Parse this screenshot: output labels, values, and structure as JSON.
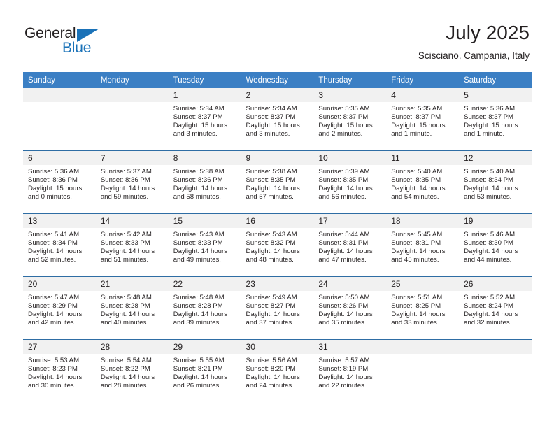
{
  "brand": {
    "name_part1": "General",
    "name_part2": "Blue",
    "triangle_color": "#1a72b8",
    "text_color": "#231f20"
  },
  "header": {
    "title": "July 2025",
    "subtitle": "Scisciano, Campania, Italy"
  },
  "calendar": {
    "header_bg": "#3b7fc4",
    "header_text_color": "#ffffff",
    "daynum_bg": "#f1f1f1",
    "week_separator_color": "#2e6da4",
    "weekdays": [
      "Sunday",
      "Monday",
      "Tuesday",
      "Wednesday",
      "Thursday",
      "Friday",
      "Saturday"
    ],
    "weeks": [
      [
        {
          "day": "",
          "lines": []
        },
        {
          "day": "",
          "lines": []
        },
        {
          "day": "1",
          "lines": [
            "Sunrise: 5:34 AM",
            "Sunset: 8:37 PM",
            "Daylight: 15 hours and 3 minutes."
          ]
        },
        {
          "day": "2",
          "lines": [
            "Sunrise: 5:34 AM",
            "Sunset: 8:37 PM",
            "Daylight: 15 hours and 3 minutes."
          ]
        },
        {
          "day": "3",
          "lines": [
            "Sunrise: 5:35 AM",
            "Sunset: 8:37 PM",
            "Daylight: 15 hours and 2 minutes."
          ]
        },
        {
          "day": "4",
          "lines": [
            "Sunrise: 5:35 AM",
            "Sunset: 8:37 PM",
            "Daylight: 15 hours and 1 minute."
          ]
        },
        {
          "day": "5",
          "lines": [
            "Sunrise: 5:36 AM",
            "Sunset: 8:37 PM",
            "Daylight: 15 hours and 1 minute."
          ]
        }
      ],
      [
        {
          "day": "6",
          "lines": [
            "Sunrise: 5:36 AM",
            "Sunset: 8:36 PM",
            "Daylight: 15 hours and 0 minutes."
          ]
        },
        {
          "day": "7",
          "lines": [
            "Sunrise: 5:37 AM",
            "Sunset: 8:36 PM",
            "Daylight: 14 hours and 59 minutes."
          ]
        },
        {
          "day": "8",
          "lines": [
            "Sunrise: 5:38 AM",
            "Sunset: 8:36 PM",
            "Daylight: 14 hours and 58 minutes."
          ]
        },
        {
          "day": "9",
          "lines": [
            "Sunrise: 5:38 AM",
            "Sunset: 8:35 PM",
            "Daylight: 14 hours and 57 minutes."
          ]
        },
        {
          "day": "10",
          "lines": [
            "Sunrise: 5:39 AM",
            "Sunset: 8:35 PM",
            "Daylight: 14 hours and 56 minutes."
          ]
        },
        {
          "day": "11",
          "lines": [
            "Sunrise: 5:40 AM",
            "Sunset: 8:35 PM",
            "Daylight: 14 hours and 54 minutes."
          ]
        },
        {
          "day": "12",
          "lines": [
            "Sunrise: 5:40 AM",
            "Sunset: 8:34 PM",
            "Daylight: 14 hours and 53 minutes."
          ]
        }
      ],
      [
        {
          "day": "13",
          "lines": [
            "Sunrise: 5:41 AM",
            "Sunset: 8:34 PM",
            "Daylight: 14 hours and 52 minutes."
          ]
        },
        {
          "day": "14",
          "lines": [
            "Sunrise: 5:42 AM",
            "Sunset: 8:33 PM",
            "Daylight: 14 hours and 51 minutes."
          ]
        },
        {
          "day": "15",
          "lines": [
            "Sunrise: 5:43 AM",
            "Sunset: 8:33 PM",
            "Daylight: 14 hours and 49 minutes."
          ]
        },
        {
          "day": "16",
          "lines": [
            "Sunrise: 5:43 AM",
            "Sunset: 8:32 PM",
            "Daylight: 14 hours and 48 minutes."
          ]
        },
        {
          "day": "17",
          "lines": [
            "Sunrise: 5:44 AM",
            "Sunset: 8:31 PM",
            "Daylight: 14 hours and 47 minutes."
          ]
        },
        {
          "day": "18",
          "lines": [
            "Sunrise: 5:45 AM",
            "Sunset: 8:31 PM",
            "Daylight: 14 hours and 45 minutes."
          ]
        },
        {
          "day": "19",
          "lines": [
            "Sunrise: 5:46 AM",
            "Sunset: 8:30 PM",
            "Daylight: 14 hours and 44 minutes."
          ]
        }
      ],
      [
        {
          "day": "20",
          "lines": [
            "Sunrise: 5:47 AM",
            "Sunset: 8:29 PM",
            "Daylight: 14 hours and 42 minutes."
          ]
        },
        {
          "day": "21",
          "lines": [
            "Sunrise: 5:48 AM",
            "Sunset: 8:28 PM",
            "Daylight: 14 hours and 40 minutes."
          ]
        },
        {
          "day": "22",
          "lines": [
            "Sunrise: 5:48 AM",
            "Sunset: 8:28 PM",
            "Daylight: 14 hours and 39 minutes."
          ]
        },
        {
          "day": "23",
          "lines": [
            "Sunrise: 5:49 AM",
            "Sunset: 8:27 PM",
            "Daylight: 14 hours and 37 minutes."
          ]
        },
        {
          "day": "24",
          "lines": [
            "Sunrise: 5:50 AM",
            "Sunset: 8:26 PM",
            "Daylight: 14 hours and 35 minutes."
          ]
        },
        {
          "day": "25",
          "lines": [
            "Sunrise: 5:51 AM",
            "Sunset: 8:25 PM",
            "Daylight: 14 hours and 33 minutes."
          ]
        },
        {
          "day": "26",
          "lines": [
            "Sunrise: 5:52 AM",
            "Sunset: 8:24 PM",
            "Daylight: 14 hours and 32 minutes."
          ]
        }
      ],
      [
        {
          "day": "27",
          "lines": [
            "Sunrise: 5:53 AM",
            "Sunset: 8:23 PM",
            "Daylight: 14 hours and 30 minutes."
          ]
        },
        {
          "day": "28",
          "lines": [
            "Sunrise: 5:54 AM",
            "Sunset: 8:22 PM",
            "Daylight: 14 hours and 28 minutes."
          ]
        },
        {
          "day": "29",
          "lines": [
            "Sunrise: 5:55 AM",
            "Sunset: 8:21 PM",
            "Daylight: 14 hours and 26 minutes."
          ]
        },
        {
          "day": "30",
          "lines": [
            "Sunrise: 5:56 AM",
            "Sunset: 8:20 PM",
            "Daylight: 14 hours and 24 minutes."
          ]
        },
        {
          "day": "31",
          "lines": [
            "Sunrise: 5:57 AM",
            "Sunset: 8:19 PM",
            "Daylight: 14 hours and 22 minutes."
          ]
        },
        {
          "day": "",
          "lines": []
        },
        {
          "day": "",
          "lines": []
        }
      ]
    ]
  }
}
